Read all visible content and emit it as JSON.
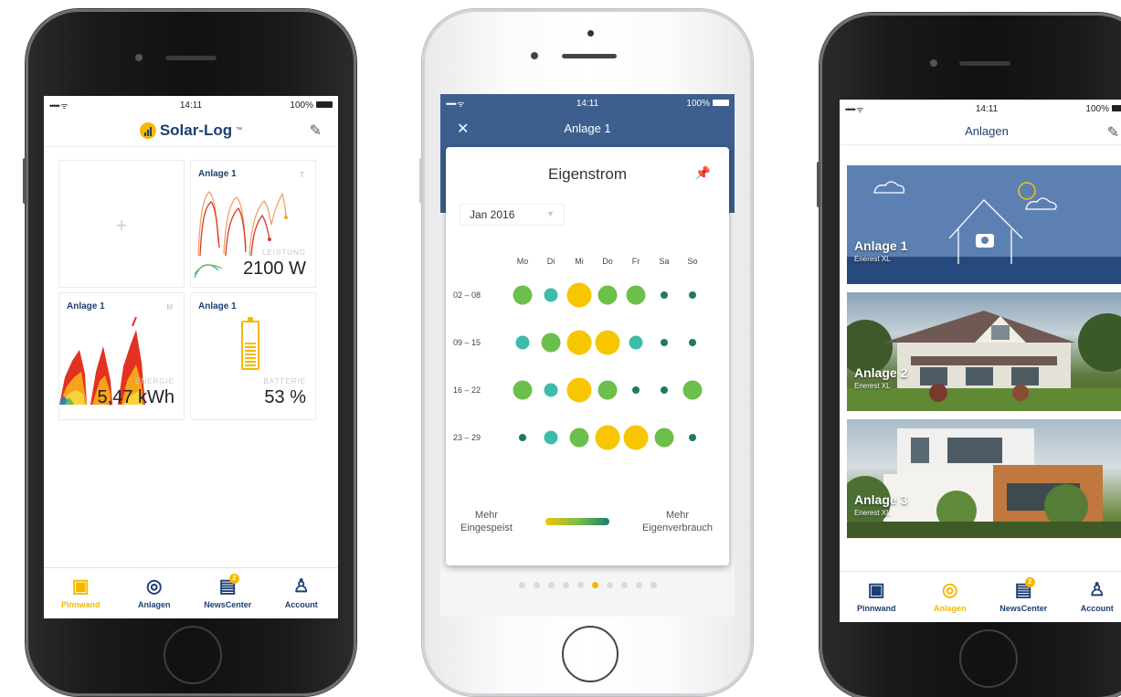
{
  "phone1": {
    "status": {
      "signal": "••••• ᯤ",
      "time": "14:11",
      "battery": "100%"
    },
    "logo_text": "Solar-Log",
    "logo_mark": "™",
    "tiles": [
      {
        "title": "",
        "period": "",
        "label": "",
        "value": "",
        "icon": "plus-icon"
      },
      {
        "title": "Anlage 1",
        "period": "T",
        "label": "LEISTUNG",
        "value": "2100 W"
      },
      {
        "title": "Anlage 1",
        "period": "M",
        "label": "ENERGIE",
        "value": "5,47 kWh"
      },
      {
        "title": "Anlage 1",
        "period": "",
        "label": "BATTERIE",
        "value": "53 %",
        "level": 0.53
      }
    ],
    "tabs": [
      {
        "label": "Pinnwand",
        "icon": "pinboard-icon",
        "active": true
      },
      {
        "label": "Anlagen",
        "icon": "plant-icon",
        "active": false
      },
      {
        "label": "NewsCenter",
        "icon": "news-icon",
        "active": false,
        "badge": "2"
      },
      {
        "label": "Account",
        "icon": "account-icon",
        "active": false
      }
    ]
  },
  "phone2": {
    "status": {
      "signal": "••••• ᯤ",
      "time": "14:11",
      "battery": "100%"
    },
    "title": "Anlage 1",
    "card_title": "Eigenstrom",
    "month": "Jan 2016",
    "days": [
      "Mo",
      "Di",
      "Mi",
      "Do",
      "Fr",
      "Sa",
      "So"
    ],
    "weeks": [
      {
        "label": "02 – 08",
        "cells": [
          {
            "c": "green",
            "s": 2
          },
          {
            "c": "teal",
            "s": 1
          },
          {
            "c": "yellow",
            "s": 3
          },
          {
            "c": "green",
            "s": 2
          },
          {
            "c": "green",
            "s": 2
          },
          {
            "c": "dark",
            "s": 0
          },
          {
            "c": "dark",
            "s": 0
          }
        ]
      },
      {
        "label": "09 – 15",
        "cells": [
          {
            "c": "teal",
            "s": 1
          },
          {
            "c": "green",
            "s": 2
          },
          {
            "c": "yellow",
            "s": 3
          },
          {
            "c": "yellow",
            "s": 3
          },
          {
            "c": "teal",
            "s": 1
          },
          {
            "c": "dark",
            "s": 0
          },
          {
            "c": "dark",
            "s": 0
          }
        ]
      },
      {
        "label": "16 – 22",
        "cells": [
          {
            "c": "green",
            "s": 2
          },
          {
            "c": "teal",
            "s": 1
          },
          {
            "c": "yellow",
            "s": 3
          },
          {
            "c": "green",
            "s": 2
          },
          {
            "c": "dark",
            "s": 0
          },
          {
            "c": "dark",
            "s": 0
          },
          {
            "c": "green",
            "s": 2
          }
        ]
      },
      {
        "label": "23 – 29",
        "cells": [
          {
            "c": "dark",
            "s": 0
          },
          {
            "c": "teal",
            "s": 1
          },
          {
            "c": "green",
            "s": 2
          },
          {
            "c": "yellow",
            "s": 3
          },
          {
            "c": "yellow",
            "s": 3
          },
          {
            "c": "green",
            "s": 2
          },
          {
            "c": "dark",
            "s": 0
          }
        ]
      }
    ],
    "legend_left": [
      "Mehr",
      "Eingespeist"
    ],
    "legend_right": [
      "Mehr",
      "Eigenverbrauch"
    ],
    "pager_count": 10,
    "pager_active": 5,
    "colors": {
      "yellow": "#f7c600",
      "green": "#6bbf4a",
      "teal": "#3dbca9",
      "dark": "#1d7a63",
      "header": "#3d5f8d"
    }
  },
  "phone3": {
    "status": {
      "signal": "••••• ᯤ",
      "time": "14:11",
      "battery": "100%"
    },
    "title": "Anlagen",
    "plants": [
      {
        "name": "Anlage 1",
        "sub": "Enerest XL",
        "kind": "illustration"
      },
      {
        "name": "Anlage 2",
        "sub": "Enerest XL",
        "kind": "house-photo"
      },
      {
        "name": "Anlage 3",
        "sub": "Enerest XL",
        "kind": "modern-house-photo"
      }
    ],
    "tabs": [
      {
        "label": "Pinnwand",
        "icon": "pinboard-icon",
        "active": false
      },
      {
        "label": "Anlagen",
        "icon": "plant-icon",
        "active": true
      },
      {
        "label": "NewsCenter",
        "icon": "news-icon",
        "active": false,
        "badge": "2"
      },
      {
        "label": "Account",
        "icon": "account-icon",
        "active": false
      }
    ]
  }
}
